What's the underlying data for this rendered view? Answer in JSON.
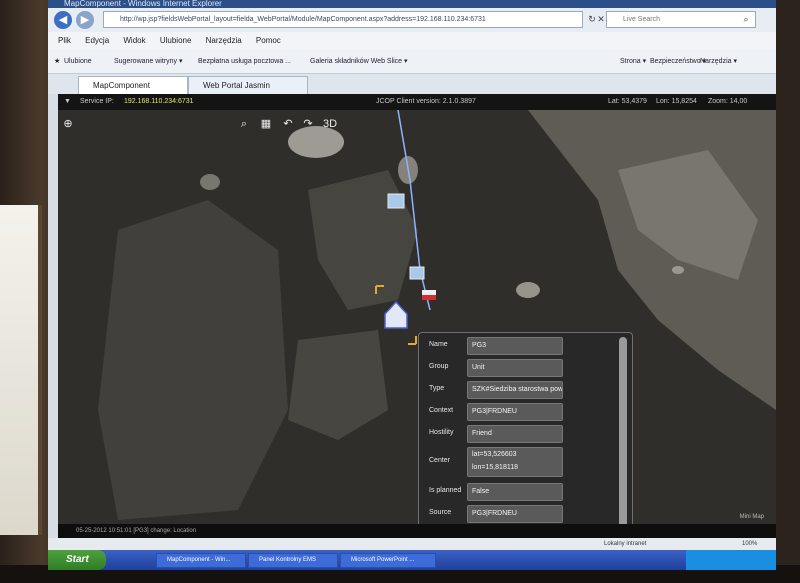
{
  "window": {
    "title": "MapComponent - Windows Internet Explorer"
  },
  "address": {
    "url": "http://wp.jsp?fieldsWebPortal_layout=fielda_WebPortal/Module/MapComponent.aspx?address=192.168.110.234:6731",
    "search_placeholder": "Live Search"
  },
  "menu": {
    "items": [
      "Plik",
      "Edycja",
      "Widok",
      "Ulubione",
      "Narzędzia",
      "Pomoc"
    ]
  },
  "favorites": {
    "label": "Ulubione",
    "items": [
      "Sugerowane witryny ▾",
      "Bezpłatna usługa pocztowa ...",
      "Galeria składników Web Slice ▾"
    ],
    "right_items": [
      "Strona ▾",
      "Bezpieczeństwo ▾",
      "Narzędzia ▾"
    ]
  },
  "tabs": [
    {
      "label": "MapComponent"
    },
    {
      "label": "Web Portal Jasmin"
    }
  ],
  "app": {
    "service_ip_label": "Service IP:",
    "service_ip": "192.168.110.234:6731",
    "client_version": "JCOP Client version: 2.1.0.3897",
    "lat_label": "Lat: 53,4379",
    "lon_label": "Lon: 15,8254",
    "zoom_label": "Zoom: 14,00",
    "mode_3d": "3D",
    "mini_map": "Mini Map"
  },
  "info_panel": {
    "fields": [
      {
        "label": "Name",
        "value": "PG3"
      },
      {
        "label": "Group",
        "value": "Unit"
      },
      {
        "label": "Type",
        "value": "SZK#Siedziba starostwa powi"
      },
      {
        "label": "Context",
        "value": "PG3|FRDNEU"
      },
      {
        "label": "Hostility",
        "value": "Friend"
      },
      {
        "label": "Center",
        "value": "lat=53,526603\nlon=15,818118"
      },
      {
        "label": "Is planned",
        "value": "False"
      },
      {
        "label": "Source",
        "value": "PG3|FRDNEU"
      }
    ]
  },
  "status": {
    "log": "05-25-2012 10:51:01 [PG3] change: Location",
    "ie_status": "Lokalny intranet",
    "zoom": "100%"
  },
  "taskbar": {
    "start": "Start",
    "items": [
      "MapComponent - Win...",
      "Panel Kontrolny EMS",
      "Microsoft PowerPoint ..."
    ]
  },
  "colors": {
    "map_bg": "#2c2b27",
    "panel_bg": "#282828",
    "taskbar": "#2a4fb4"
  }
}
